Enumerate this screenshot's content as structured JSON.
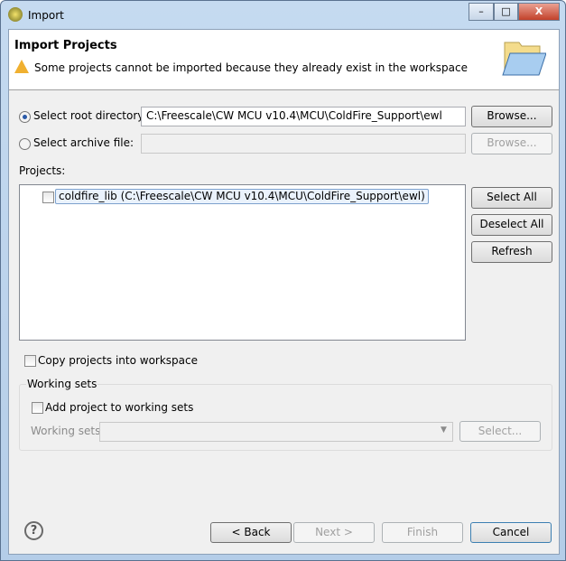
{
  "window": {
    "title": "Import",
    "minimize": "–",
    "maximize": "□",
    "close": "X"
  },
  "header": {
    "title": "Import Projects",
    "message": "Some projects cannot be imported because they already exist in the workspace",
    "warning_icon": "warning-icon",
    "banner_icon": "open-folder-icon"
  },
  "source": {
    "root_label": "Select root directory:",
    "root_value": "C:\\Freescale\\CW MCU v10.4\\MCU\\ColdFire_Support\\ewl",
    "root_selected": true,
    "archive_label": "Select archive file:",
    "archive_value": "",
    "archive_selected": false,
    "browse": "Browse...",
    "browse_archive": "Browse..."
  },
  "projects": {
    "label": "Projects:",
    "items": [
      {
        "label": "coldfire_lib (C:\\Freescale\\CW MCU v10.4\\MCU\\ColdFire_Support\\ewl)",
        "checked": false
      }
    ],
    "select_all": "Select All",
    "deselect_all": "Deselect All",
    "refresh": "Refresh"
  },
  "copy_label": "Copy projects into workspace",
  "working_sets": {
    "legend": "Working sets",
    "add_label": "Add project to working sets",
    "sets_label": "Working sets:",
    "sets_value": "",
    "select": "Select..."
  },
  "footer": {
    "help": "?",
    "back": "< Back",
    "next": "Next >",
    "finish": "Finish",
    "cancel": "Cancel"
  }
}
